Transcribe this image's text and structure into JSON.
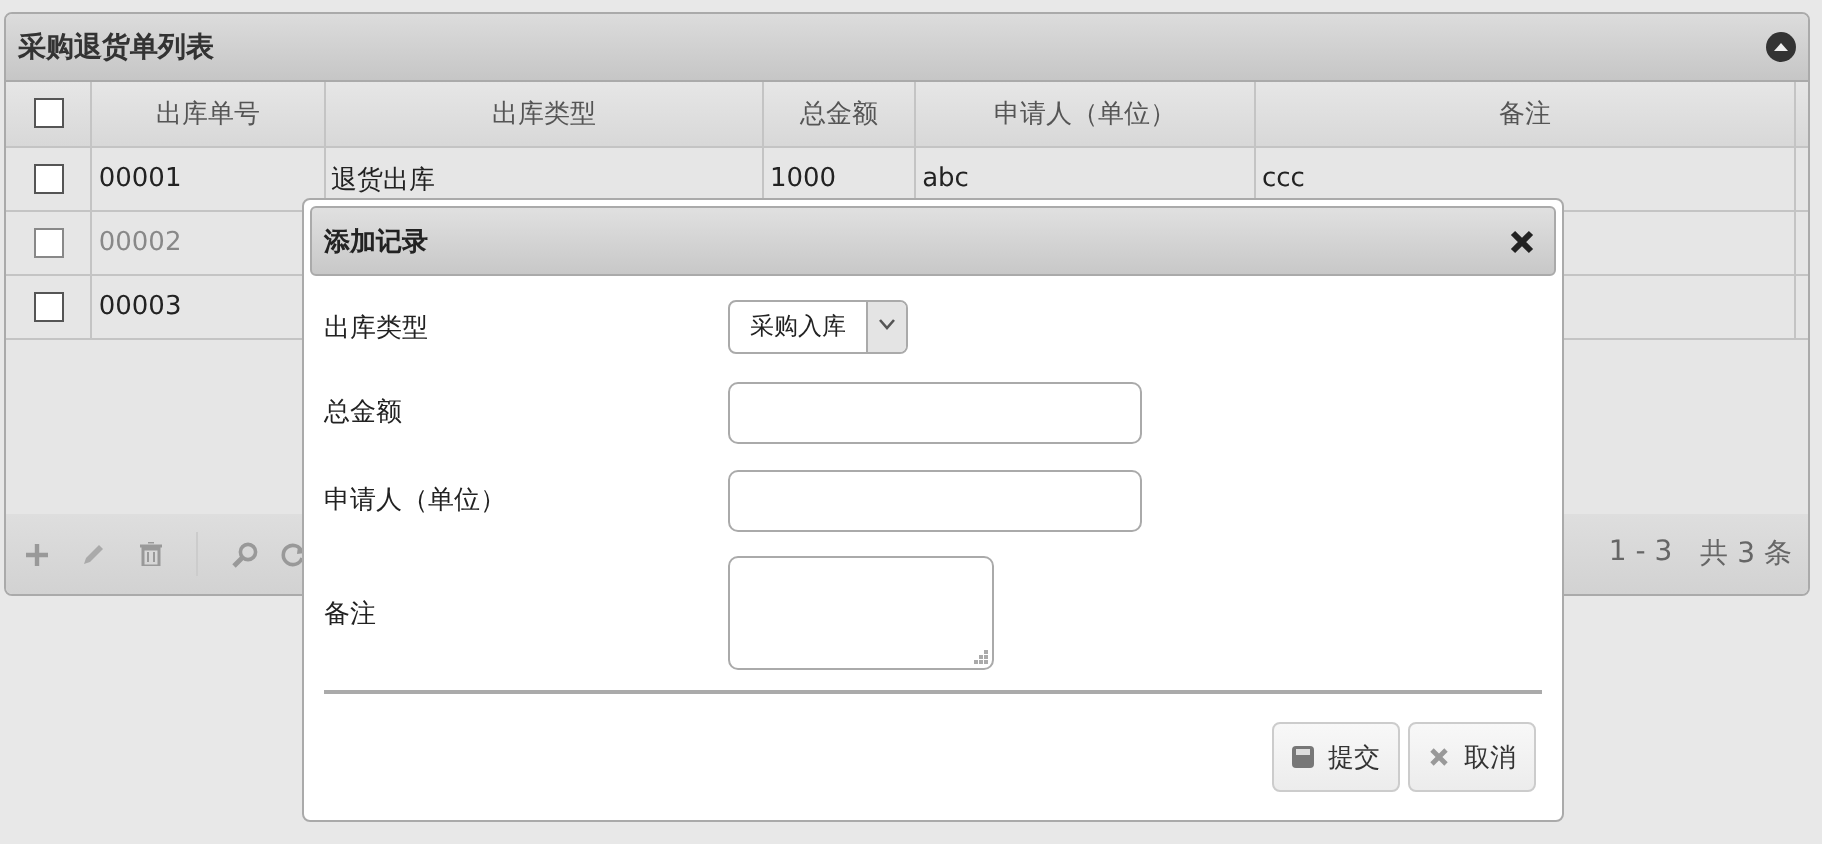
{
  "panel": {
    "title": "采购退货单列表"
  },
  "table": {
    "all_checked": false,
    "columns": [
      "出库单号",
      "出库类型",
      "总金额",
      "申请人（单位）",
      "备注"
    ],
    "rows": [
      {
        "checked": false,
        "disabled": false,
        "cells": [
          "00001",
          "退货出库",
          "1000",
          "abc",
          "ccc"
        ]
      },
      {
        "checked": false,
        "disabled": true,
        "cells": [
          "00002"
        ]
      },
      {
        "checked": false,
        "disabled": false,
        "cells": [
          "00003"
        ]
      }
    ]
  },
  "pager": {
    "range": "1 - 3",
    "total": "共 3 条"
  },
  "dialog": {
    "title": "添加记录",
    "fields": [
      {
        "kind": "select",
        "label": "出库类型",
        "value": "采购入库"
      },
      {
        "kind": "input",
        "label": "总金额"
      },
      {
        "kind": "input",
        "label": "申请人（单位）"
      },
      {
        "kind": "textarea",
        "label": "备注"
      }
    ],
    "buttons": [
      {
        "kind": "save",
        "label": "提交"
      },
      {
        "kind": "cancel",
        "label": "取消"
      }
    ]
  }
}
